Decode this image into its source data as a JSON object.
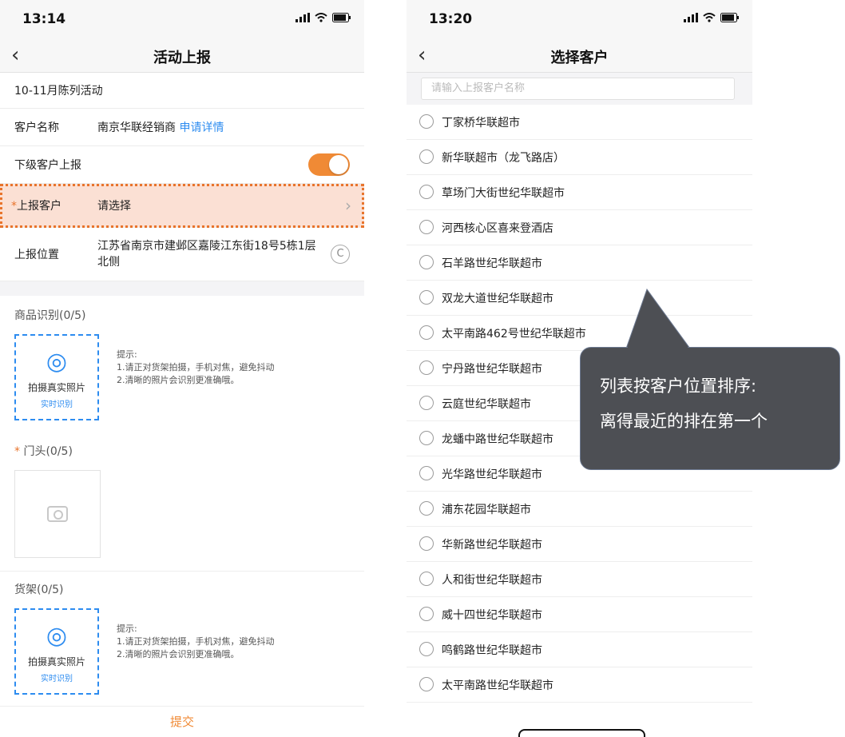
{
  "left": {
    "status_time": "13:14",
    "title": "活动上报",
    "activity": "10-11月陈列活动",
    "customer_label": "客户名称",
    "customer_value": "南京华联经销商",
    "customer_link": "申请详情",
    "sub_report_label": "下级客户上报",
    "sub_report_on": true,
    "report_customer_required": "*",
    "report_customer_label": "上报客户",
    "report_customer_placeholder": "请选择",
    "location_label": "上报位置",
    "location_value": "江苏省南京市建邺区嘉陵江东街18号5栋1层北侧",
    "products_title": "商品识别(0/5)",
    "scan_label": "拍摄真实照片",
    "scan_sub": "实时识别",
    "tips_title": "提示:",
    "tip1": "1.请正对货架拍摄，手机对焦，避免抖动",
    "tip2": "2.清晰的照片会识别更准确哦。",
    "door_required": "*",
    "door_title": "门头(0/5)",
    "shelf_title": "货架(0/5)",
    "submit": "提交"
  },
  "right": {
    "status_time": "13:20",
    "title": "选择客户",
    "search_placeholder": "请输入上报客户名称",
    "customers": [
      "丁家桥华联超市",
      "新华联超市（龙飞路店）",
      "草场门大街世纪华联超市",
      "河西核心区喜来登酒店",
      "石羊路世纪华联超市",
      "双龙大道世纪华联超市",
      "太平南路462号世纪华联超市",
      "宁丹路世纪华联超市",
      "云庭世纪华联超市",
      "龙蟠中路世纪华联超市",
      "光华路世纪华联超市",
      "浦东花园华联超市",
      "华新路世纪华联超市",
      "人和街世纪华联超市",
      "威十四世纪华联超市",
      "鸣鹤路世纪华联超市",
      "太平南路世纪华联超市"
    ]
  },
  "callout": {
    "line1": "列表按客户位置排序:",
    "line2": "离得最近的排在第一个"
  },
  "colors": {
    "accent": "#f08a35",
    "link": "#2d8cf0",
    "highlight_bg": "#fbe0d4",
    "highlight_border": "#e8742c",
    "callout_bg": "#4d4f54"
  }
}
